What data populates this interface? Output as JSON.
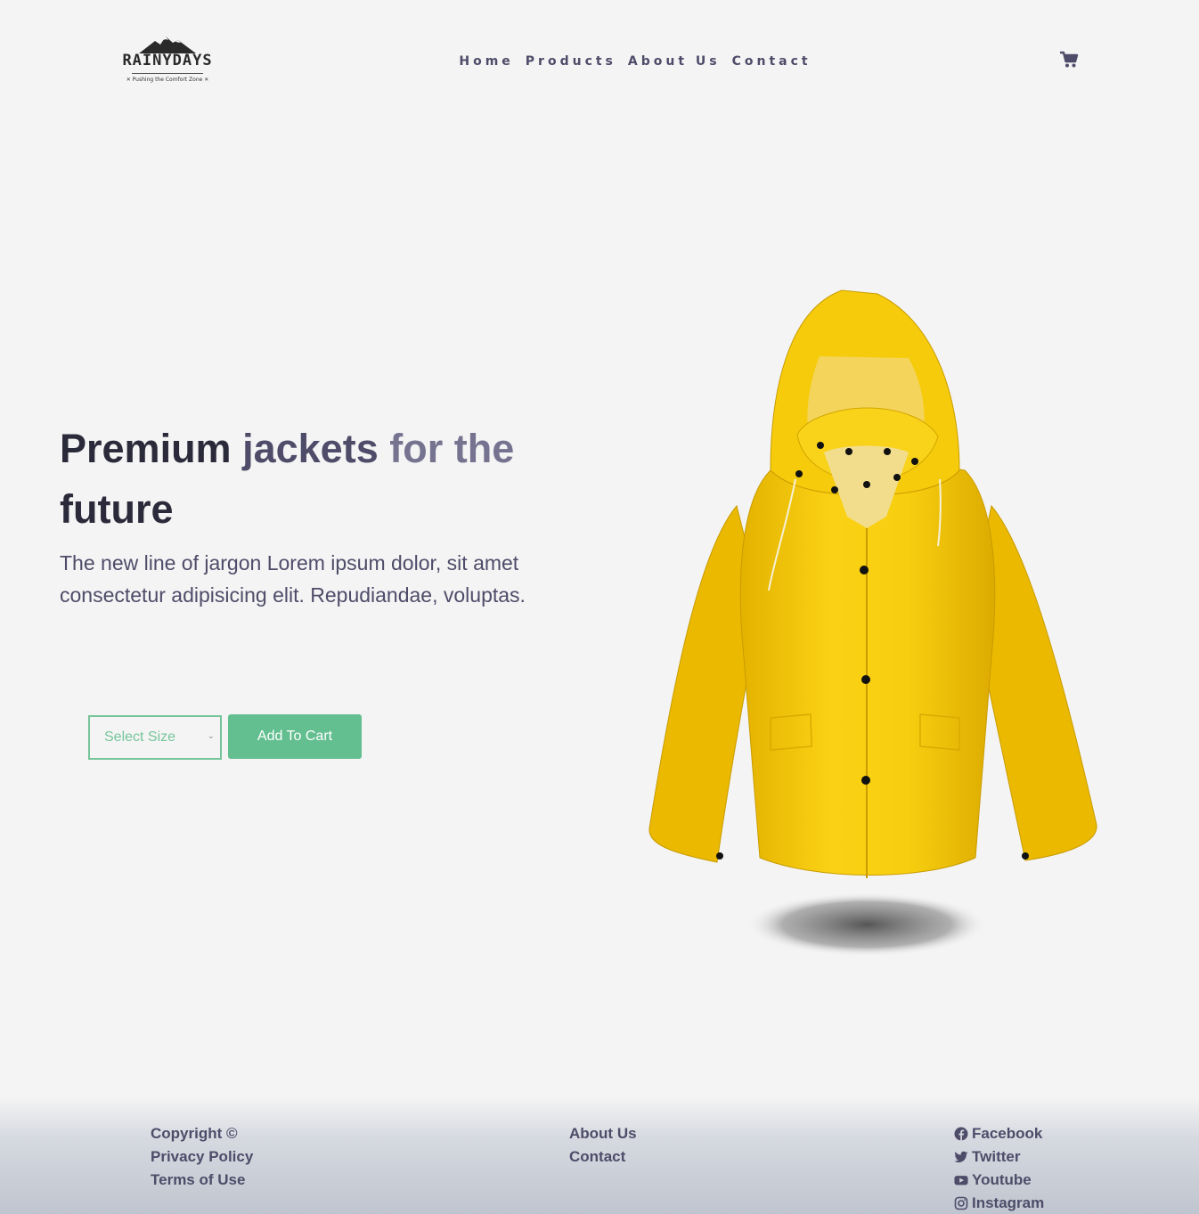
{
  "brand": {
    "name": "RAINYDAYS",
    "tagline": "✕ Pushing the Comfort Zone ✕"
  },
  "nav": {
    "items": [
      {
        "label": "Home"
      },
      {
        "label": "Products"
      },
      {
        "label": "About Us"
      },
      {
        "label": "Contact"
      }
    ]
  },
  "hero": {
    "headline": {
      "w1": "Premium",
      "w2": "jackets",
      "w3": "for the",
      "w4": "future"
    },
    "lead": "The new line of jargon Lorem ipsum dolor, sit amet consectetur adipisicing elit. Repudiandae, voluptas.",
    "size_select": "Select Size",
    "add_to_cart": "Add To Cart",
    "jacket_color": "#f7cd0c"
  },
  "footer": {
    "legal": [
      "Copyright ©",
      "Privacy Policy",
      "Terms of Use"
    ],
    "links": [
      "About Us",
      "Contact"
    ],
    "social": [
      {
        "label": "Facebook",
        "icon": "facebook-icon"
      },
      {
        "label": "Twitter",
        "icon": "twitter-icon"
      },
      {
        "label": "Youtube",
        "icon": "youtube-icon"
      },
      {
        "label": "Instagram",
        "icon": "instagram-icon"
      }
    ]
  },
  "colors": {
    "accent": "#63bf90",
    "nav_text": "#4e4c69",
    "background": "#f4f4f4"
  }
}
